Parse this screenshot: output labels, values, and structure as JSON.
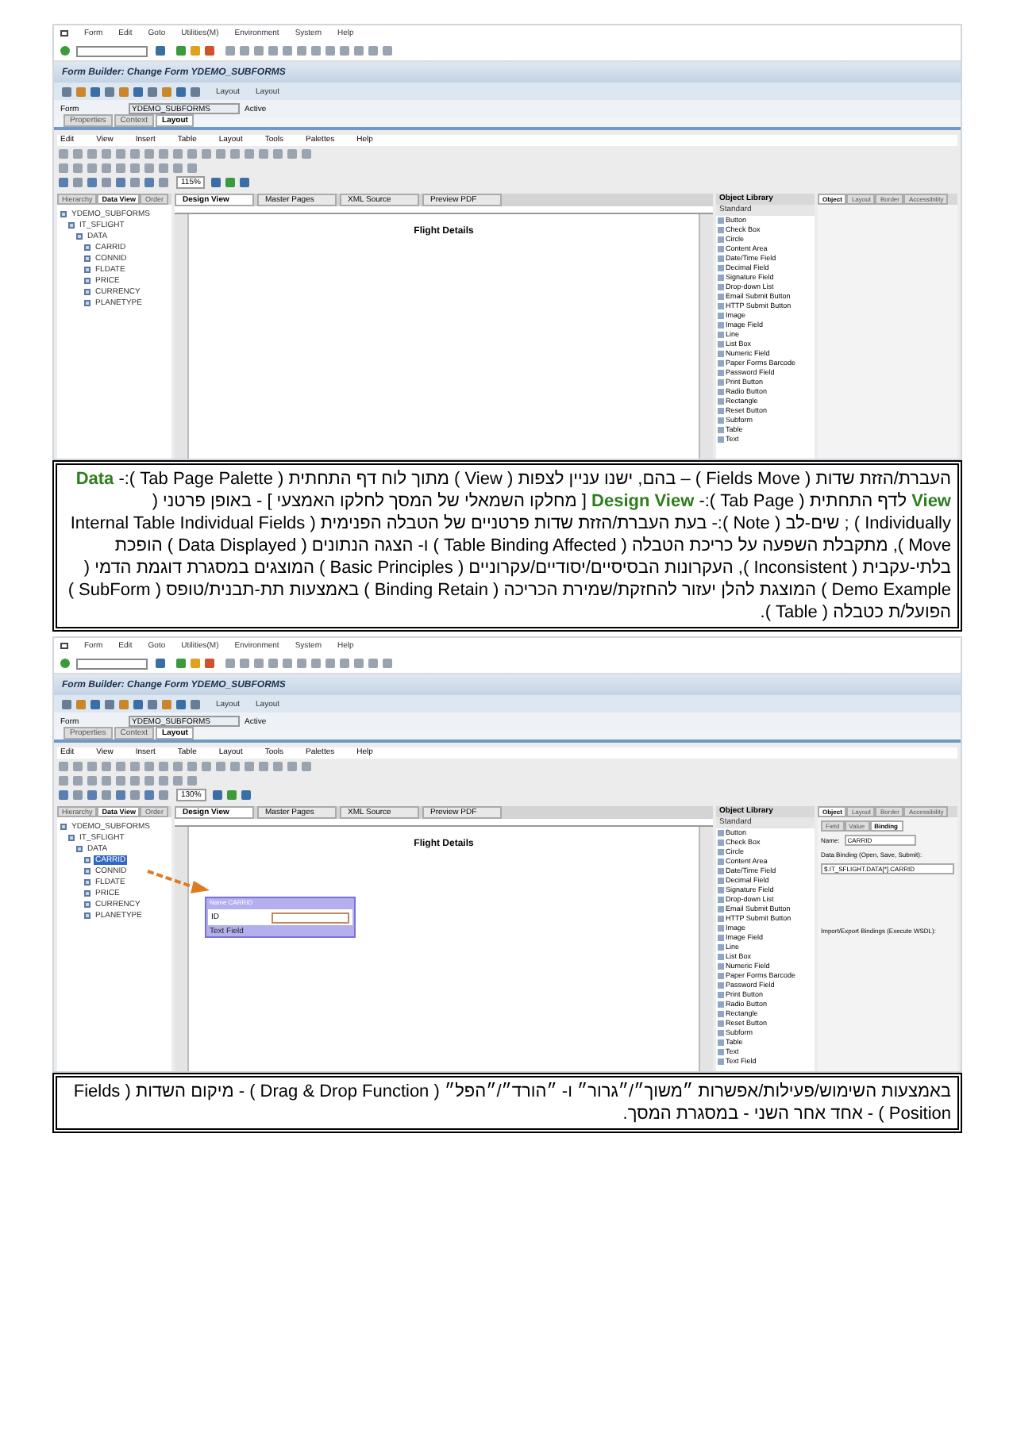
{
  "screenshots": [
    {
      "menu": [
        "Form",
        "Edit",
        "Goto",
        "Utilities(M)",
        "Environment",
        "System",
        "Help"
      ],
      "title": "Form Builder: Change Form YDEMO_SUBFORMS",
      "app_buttons": [
        "Layout",
        "Layout"
      ],
      "form": {
        "label": "Form",
        "value": "YDEMO_SUBFORMS",
        "status": "Active"
      },
      "tabs": [
        {
          "label": "Properties",
          "selected": false
        },
        {
          "label": "Context",
          "selected": false
        },
        {
          "label": "Layout",
          "selected": true
        }
      ],
      "designer_menu": [
        "Edit",
        "View",
        "Insert",
        "Table",
        "Layout",
        "Tools",
        "Palettes",
        "Help"
      ],
      "zoom": "115%",
      "left_tabs": [
        {
          "label": "Hierarchy",
          "selected": false
        },
        {
          "label": "Data View",
          "selected": true
        },
        {
          "label": "Order",
          "selected": false
        }
      ],
      "tree": [
        {
          "label": "YDEMO_SUBFORMS",
          "selected": false,
          "children": [
            {
              "label": "IT_SFLIGHT",
              "selected": false,
              "children": [
                {
                  "label": "DATA",
                  "selected": false,
                  "children": [
                    {
                      "label": "CARRID",
                      "selected": false
                    },
                    {
                      "label": "CONNID",
                      "selected": false
                    },
                    {
                      "label": "FLDATE",
                      "selected": false
                    },
                    {
                      "label": "PRICE",
                      "selected": false
                    },
                    {
                      "label": "CURRENCY",
                      "selected": false
                    },
                    {
                      "label": "PLANETYPE",
                      "selected": false
                    }
                  ]
                }
              ]
            }
          ]
        }
      ],
      "center_tabs": [
        {
          "label": "Design View",
          "selected": true
        },
        {
          "label": "Master Pages",
          "selected": false
        },
        {
          "label": "XML Source",
          "selected": false
        },
        {
          "label": "Preview PDF",
          "selected": false
        }
      ],
      "page_title": "Flight Details",
      "library": {
        "title": "Object Library",
        "group": "Standard",
        "items": [
          "Button",
          "Check Box",
          "Circle",
          "Content Area",
          "Date/Time Field",
          "Decimal Field",
          "Signature Field",
          "Drop-down List",
          "Email Submit Button",
          "HTTP Submit Button",
          "Image",
          "Image Field",
          "Line",
          "List Box",
          "Numeric Field",
          "Paper Forms Barcode",
          "Password Field",
          "Print Button",
          "Radio Button",
          "Rectangle",
          "Reset Button",
          "Subform",
          "Table",
          "Text"
        ]
      },
      "object_tabs": [
        {
          "label": "Object",
          "selected": true
        },
        {
          "label": "Layout",
          "selected": false
        },
        {
          "label": "Border",
          "selected": false
        },
        {
          "label": "Accessibility",
          "selected": false
        }
      ]
    },
    {
      "menu": [
        "Form",
        "Edit",
        "Goto",
        "Utilities(M)",
        "Environment",
        "System",
        "Help"
      ],
      "title": "Form Builder: Change Form YDEMO_SUBFORMS",
      "app_buttons": [
        "Layout",
        "Layout"
      ],
      "form": {
        "label": "Form",
        "value": "YDEMO_SUBFORMS",
        "status": "Active"
      },
      "tabs": [
        {
          "label": "Properties",
          "selected": false
        },
        {
          "label": "Context",
          "selected": false
        },
        {
          "label": "Layout",
          "selected": true
        }
      ],
      "designer_menu": [
        "Edit",
        "View",
        "Insert",
        "Table",
        "Layout",
        "Tools",
        "Palettes",
        "Help"
      ],
      "zoom": "130%",
      "left_tabs": [
        {
          "label": "Hierarchy",
          "selected": false
        },
        {
          "label": "Data View",
          "selected": true
        },
        {
          "label": "Order",
          "selected": false
        }
      ],
      "tree": [
        {
          "label": "YDEMO_SUBFORMS",
          "selected": false,
          "children": [
            {
              "label": "IT_SFLIGHT",
              "selected": false,
              "children": [
                {
                  "label": "DATA",
                  "selected": false,
                  "children": [
                    {
                      "label": "CARRID",
                      "selected": true
                    },
                    {
                      "label": "CONNID",
                      "selected": false
                    },
                    {
                      "label": "FLDATE",
                      "selected": false
                    },
                    {
                      "label": "PRICE",
                      "selected": false
                    },
                    {
                      "label": "CURRENCY",
                      "selected": false
                    },
                    {
                      "label": "PLANETYPE",
                      "selected": false
                    }
                  ]
                }
              ]
            }
          ]
        }
      ],
      "center_tabs": [
        {
          "label": "Design View",
          "selected": true
        },
        {
          "label": "Master Pages",
          "selected": false
        },
        {
          "label": "XML Source",
          "selected": false
        },
        {
          "label": "Preview PDF",
          "selected": false
        }
      ],
      "page_title": "Flight Details",
      "dropped_field": {
        "caption": "Name CARRID",
        "label": "ID",
        "type": "Text Field"
      },
      "library": {
        "title": "Object Library",
        "group": "Standard",
        "items": [
          "Button",
          "Check Box",
          "Circle",
          "Content Area",
          "Date/Time Field",
          "Decimal Field",
          "Signature Field",
          "Drop-down List",
          "Email Submit Button",
          "HTTP Submit Button",
          "Image",
          "Image Field",
          "Line",
          "List Box",
          "Numeric Field",
          "Paper Forms Barcode",
          "Password Field",
          "Print Button",
          "Radio Button",
          "Rectangle",
          "Reset Button",
          "Subform",
          "Table",
          "Text",
          "Text Field"
        ]
      },
      "object_tabs": [
        {
          "label": "Object",
          "selected": true
        },
        {
          "label": "Layout",
          "selected": false
        },
        {
          "label": "Border",
          "selected": false
        },
        {
          "label": "Accessibility",
          "selected": false
        }
      ],
      "object_subtabs": [
        {
          "label": "Field",
          "selected": false
        },
        {
          "label": "Value",
          "selected": false
        },
        {
          "label": "Binding",
          "selected": true
        }
      ],
      "binding": {
        "name_label": "Name:",
        "name": "CARRID",
        "data_binding_label": "Data Binding (Open, Save, Submit):",
        "data_binding": "$.IT_SFLIGHT.DATA[*].CARRID",
        "import_label": "Import/Export Bindings (Execute WSDL):"
      }
    }
  ],
  "notes": [
    "העברת/הזזת שדות ( Fields Move ) – בהם, ישנו עניין לצפות ( View ) מתוך לוח דף התחתית ( Tab Page Palette ):- **Data View** לדף התחתית ( Tab Page ):- **Design View** [ מחלקו השמאלי של המסך לחלקו האמצעי ] - באופן פרטני ( Individually ) ; שים-לב ( Note ):- בעת העברת/הזזת שדות פרטניים של הטבלה הפנימית ( Internal Table Individual Fields Move ), מתקבלת השפעה על כריכת הטבלה ( Table Binding Affected ) ו- הצגה הנתונים ( Data Displayed ) הופכת בלתי-עקבית ( Inconsistent ), העקרונות הבסיסיים/יסודיים/עקרוניים ( Basic Principles ) המוצגים במסגרת דוגמת הדמי ( Demo Example ) המוצגת להלן יעזור להחזקת/שמירת הכריכה ( Binding Retain ) באמצעות תת-תבנית/טופס ( SubForm ) הפועל/ת כטבלה ( Table ).",
    "באמצעות השימוש/פעילות/אפשרות ״משוך״/״גרור״ ו- ״הורד״/״הפל״ ( Drag & Drop Function ) - מיקום השדות ( Fields Position ) - אחד אחר השני - במסגרת המסך."
  ]
}
